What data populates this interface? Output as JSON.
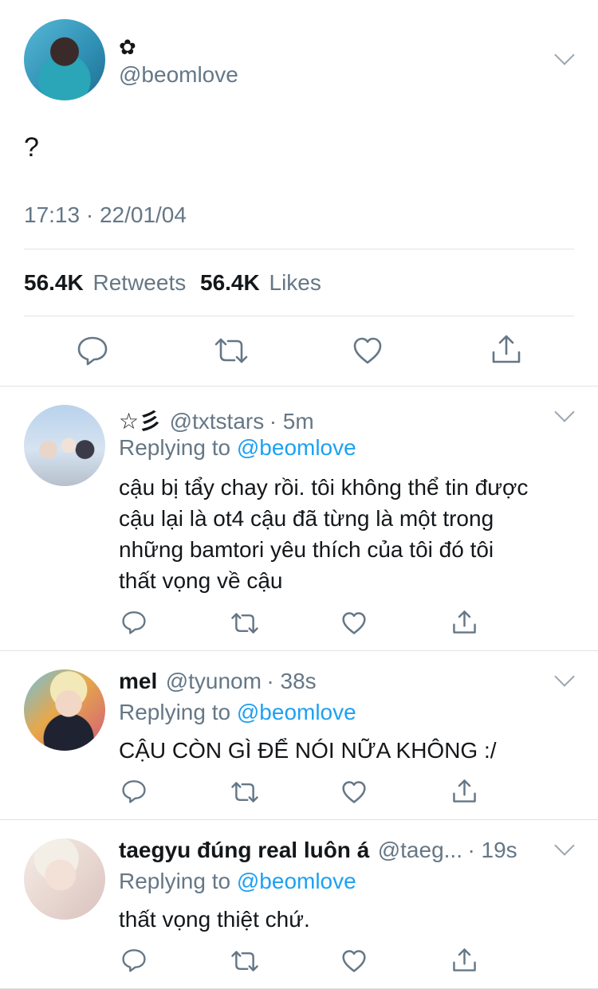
{
  "tweet": {
    "display_name": "✿",
    "handle": "@beomlove",
    "text": "?",
    "timestamp": "17:13 · 22/01/04",
    "retweet_count": "56.4K",
    "retweet_label": "Retweets",
    "like_count": "56.4K",
    "like_label": "Likes"
  },
  "replies": [
    {
      "display_name": "☆彡",
      "handle": "@txtstars",
      "time": "· 5m",
      "replying_prefix": "Replying to",
      "replying_to": "@beomlove",
      "text_lines": [
        "cậu bị tẩy chay rồi. tôi không thể tin được",
        "cậu lại là ot4 cậu đã từng là một trong",
        "những bamtori yêu thích của tôi đó tôi",
        "thất vọng về cậu"
      ]
    },
    {
      "display_name": "mel",
      "handle": "@tyunom",
      "time": "· 38s",
      "replying_prefix": "Replying to",
      "replying_to": "@beomlove",
      "text_lines": [
        "CẬU CÒN GÌ ĐỂ NÓI NỮA KHÔNG :/"
      ]
    },
    {
      "display_name": "taegyu đúng real luôn á",
      "handle": "@taeg...",
      "time": "· 19s",
      "replying_prefix": "Replying to",
      "replying_to": "@beomlove",
      "text_lines": [
        "thất vọng thiệt chứ."
      ]
    }
  ],
  "icons": {
    "reply": "reply-icon",
    "retweet": "retweet-icon",
    "like": "heart-icon",
    "share": "share-icon",
    "more": "chevron-down-icon"
  },
  "colors": {
    "text": "#14171a",
    "secondary": "#657786",
    "accent": "#1da1f2",
    "icon": "#657786",
    "divider": "#dfe3e6"
  }
}
